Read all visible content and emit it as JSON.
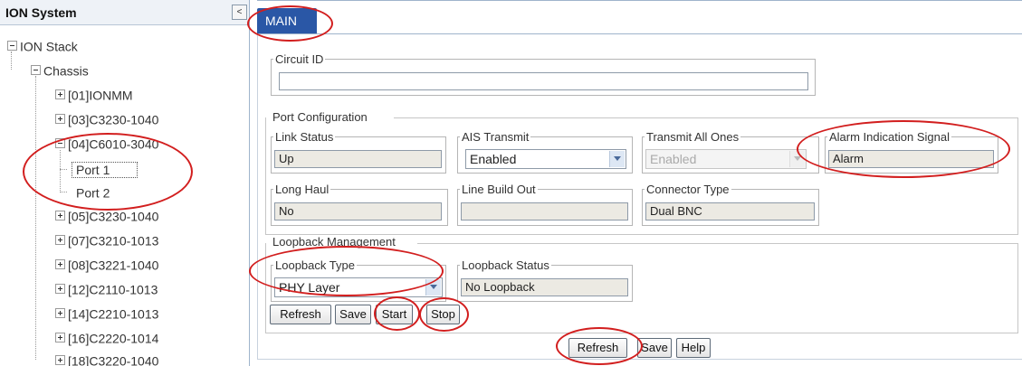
{
  "sidebar": {
    "title": "ION System",
    "collapse_glyph": "<",
    "tree": {
      "root": "ION Stack",
      "chassis": "Chassis",
      "modules": [
        {
          "label": "[01]IONMM"
        },
        {
          "label": "[03]C3230-1040"
        },
        {
          "label": "[04]C6010-3040",
          "ports": [
            "Port 1",
            "Port 2"
          ]
        },
        {
          "label": "[05]C3230-1040"
        },
        {
          "label": "[07]C3210-1013"
        },
        {
          "label": "[08]C3221-1040"
        },
        {
          "label": "[12]C2110-1013"
        },
        {
          "label": "[14]C2210-1013"
        },
        {
          "label": "[16]C2220-1014"
        },
        {
          "label": "[18]C3220-1040"
        }
      ]
    }
  },
  "main": {
    "tab_label": "MAIN",
    "circuit_id": {
      "legend": "Circuit ID",
      "value": ""
    },
    "port_config": {
      "title": "Port Configuration",
      "link_status": {
        "legend": "Link Status",
        "value": "Up"
      },
      "ais_transmit": {
        "legend": "AIS Transmit",
        "value": "Enabled"
      },
      "transmit_all_ones": {
        "legend": "Transmit All Ones",
        "value": "Enabled"
      },
      "alarm_indication_signal": {
        "legend": "Alarm Indication Signal",
        "value": "Alarm"
      },
      "long_haul": {
        "legend": "Long Haul",
        "value": "No"
      },
      "line_build_out": {
        "legend": "Line Build Out",
        "value": ""
      },
      "connector_type": {
        "legend": "Connector Type",
        "value": "Dual BNC"
      }
    },
    "loopback": {
      "title": "Loopback Management",
      "type": {
        "legend": "Loopback Type",
        "value": "PHY Layer"
      },
      "status": {
        "legend": "Loopback Status",
        "value": "No Loopback"
      },
      "buttons": {
        "refresh": "Refresh",
        "save": "Save",
        "start": "Start",
        "stop": "Stop"
      }
    },
    "footer_buttons": {
      "refresh": "Refresh",
      "save": "Save",
      "help": "Help"
    }
  },
  "colors": {
    "tab_background": "#2a57a6",
    "annotation_red": "#d21e1e",
    "readonly_field": "#eceae3"
  }
}
